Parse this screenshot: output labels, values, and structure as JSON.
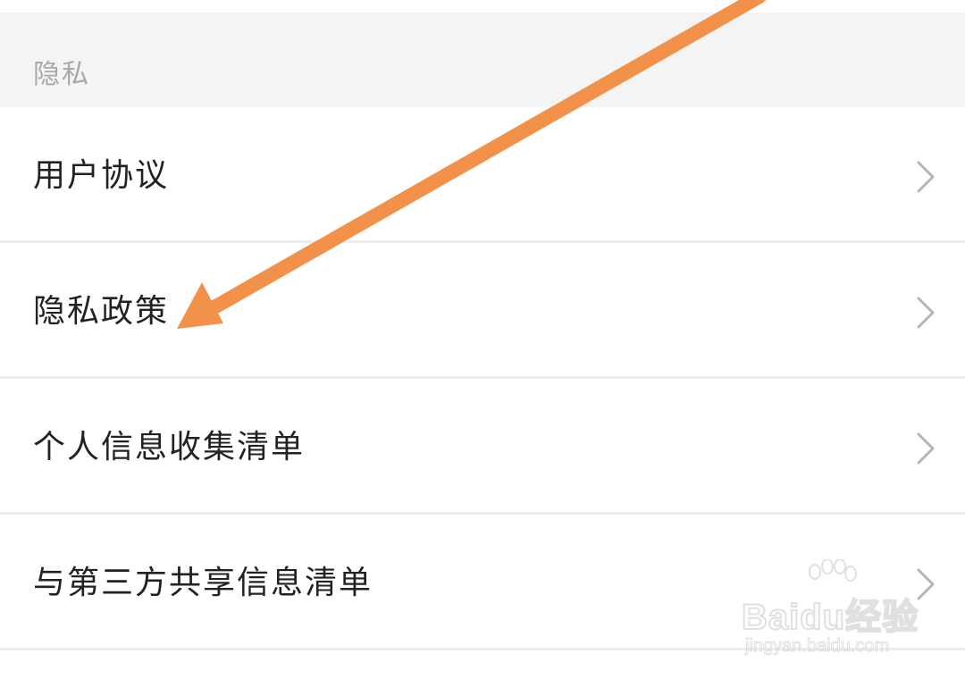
{
  "section": {
    "title": "隐私"
  },
  "menu": {
    "items": [
      {
        "label": "用户协议",
        "icon": "chevron-right-icon"
      },
      {
        "label": "隐私政策",
        "icon": "chevron-right-icon"
      },
      {
        "label": "个人信息收集清单",
        "icon": "chevron-right-icon"
      },
      {
        "label": "与第三方共享信息清单",
        "icon": "chevron-right-icon"
      }
    ]
  },
  "annotation": {
    "type": "arrow",
    "color": "#f2924a",
    "points_to": "隐私政策"
  },
  "watermark": {
    "logo_text": "Baidu经验",
    "sub_text": "jingyan.baidu.com"
  },
  "colors": {
    "section_bg": "#f4f4f4",
    "section_text": "#a9a9a9",
    "item_text": "#222222",
    "divider": "#ededed",
    "chevron": "#b5b5b5"
  }
}
